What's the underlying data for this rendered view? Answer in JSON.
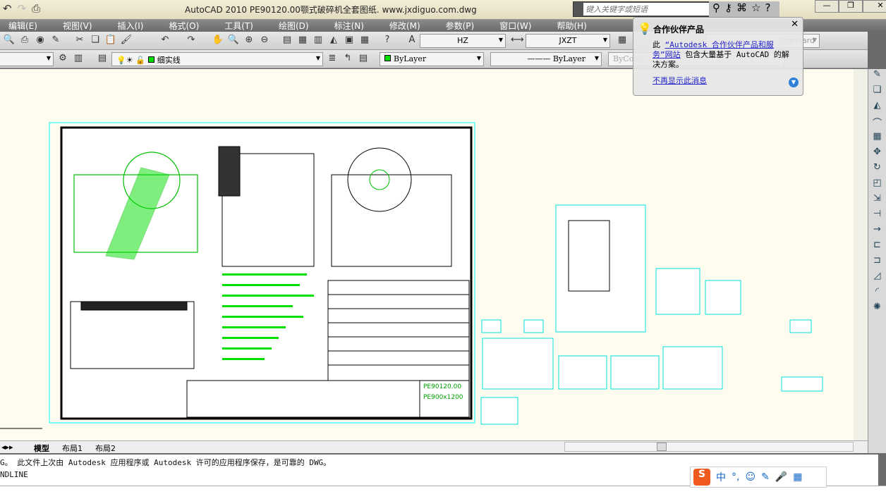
{
  "title": "AutoCAD 2010      PE90120.00颚式破碎机全套图纸. www.jxdiguo.com.dwg",
  "search": {
    "placeholder": "键入关键字或短语"
  },
  "menu": [
    "编辑(E)",
    "视图(V)",
    "插入(I)",
    "格式(O)",
    "工具(T)",
    "绘图(D)",
    "标注(N)",
    "修改(M)",
    "参数(P)",
    "窗口(W)",
    "帮助(H)"
  ],
  "toolbar": {
    "text_style": "HZ",
    "dim_style": "JXZT",
    "table_style": "Standard",
    "ml_style": "Standard",
    "layer": "细实线",
    "color": "ByLayer",
    "linetype": "ByLayer",
    "lineweight": "ByColor"
  },
  "popup": {
    "title": "合作伙伴产品",
    "prefix": "此",
    "link": "“Autodesk 合作伙伴产品和服务”网站",
    "body": "包含大量基于 AutoCAD 的解决方案。",
    "dismiss": "不再显示此消息"
  },
  "tabs": [
    "模型",
    "布局1",
    "布局2"
  ],
  "command": {
    "line1": "G。   此文件上次由 Autodesk 应用程序或 Autodesk 许可的应用程序保存，是可靠的 DWG。",
    "line2": "NDLINE"
  },
  "ime": {
    "mode": "中",
    "punct": "°,"
  },
  "drawing": {
    "table_header": "PE90120.00",
    "title_block": "PE900x1200"
  },
  "colors": {
    "canvas": "#fefcee",
    "drawing_green": "#00e000",
    "sheet_border": "#00ffff",
    "link": "#2222cc"
  }
}
